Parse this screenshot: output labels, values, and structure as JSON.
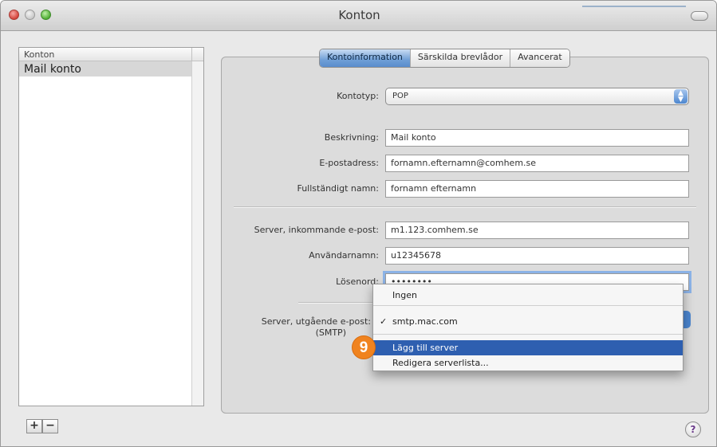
{
  "window": {
    "title": "Konton"
  },
  "sidebar": {
    "header": "Konton",
    "accounts": [
      "Mail konto"
    ],
    "add_label": "+",
    "remove_label": "−"
  },
  "tabs": [
    "Kontoinformation",
    "Särskilda brevlådor",
    "Avancerat"
  ],
  "form": {
    "account_type_label": "Kontotyp:",
    "account_type_value": "POP",
    "description_label": "Beskrivning:",
    "description_value": "Mail konto",
    "email_label": "E-postadress:",
    "email_value": "fornamn.efternamn@comhem.se",
    "fullname_label": "Fullständigt namn:",
    "fullname_value": "fornamn efternamn",
    "incoming_label": "Server, inkommande e-post:",
    "incoming_value": "m1.123.comhem.se",
    "username_label": "Användarnamn:",
    "username_value": "u12345678",
    "password_label": "Lösenord:",
    "password_value": "••••••••",
    "outgoing_label": "Server, utgående e-post:",
    "outgoing_sub": "(SMTP)"
  },
  "menu": {
    "items": [
      "Ingen",
      "smtp.mac.com",
      "Lägg till server",
      "Redigera serverlista..."
    ],
    "checked_index": 1,
    "highlighted_index": 2
  },
  "badge": {
    "number": "9",
    "color": "#f0831f"
  },
  "help": {
    "label": "?"
  }
}
